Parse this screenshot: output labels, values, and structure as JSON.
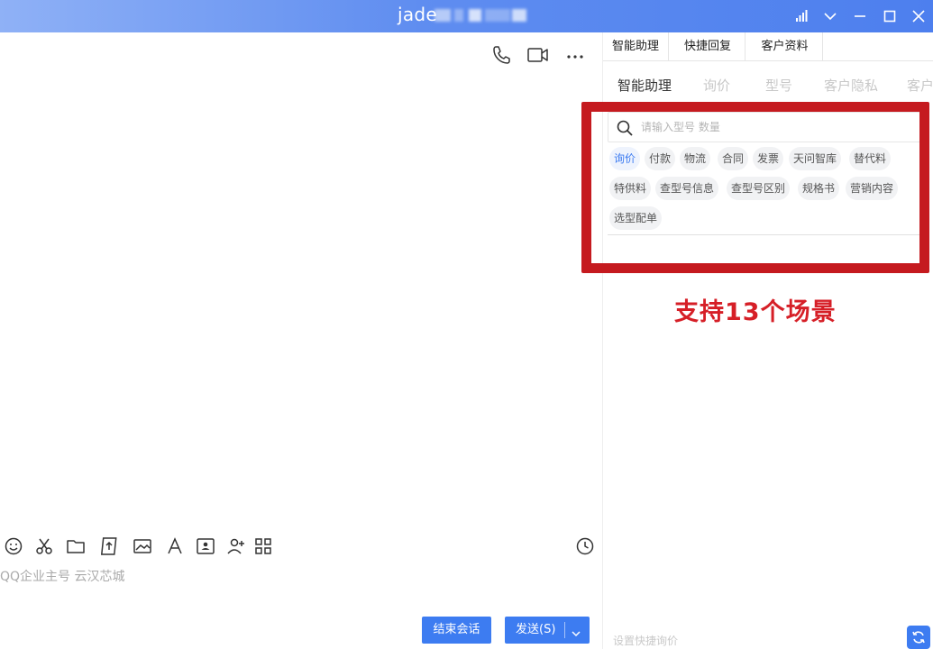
{
  "window": {
    "title": "jade"
  },
  "chat": {
    "input_placeholder": "QQ企业主号 云汉芯城",
    "end_button": "结束会话",
    "send_button": "发送(S)"
  },
  "panel": {
    "tabs": [
      "智能助理",
      "快捷回复",
      "客户资料"
    ],
    "subtabs": [
      "智能助理",
      "询价",
      "型号",
      "客户隐私",
      "客户"
    ],
    "search_placeholder": "请输入型号 数量",
    "chips": [
      "询价",
      "付款",
      "物流",
      "合同",
      "发票",
      "天问智库",
      "替代料",
      "特供料",
      "查型号信息",
      "查型号区别",
      "规格书",
      "营销内容",
      "选型配单"
    ],
    "quick_reply_hint": "设置快捷询价"
  },
  "annotation": {
    "text": "支持13个场景",
    "color": "#d61f27"
  },
  "colors": {
    "accent": "#3d7cf1",
    "highlight_frame": "#c51a1f"
  },
  "icons": {
    "titlebar": [
      "signal-icon",
      "chevron-down-icon",
      "minimize-icon",
      "maximize-icon",
      "close-icon"
    ],
    "chat_header": [
      "phone-icon",
      "video-call-icon",
      "more-icon"
    ],
    "input_toolbar": [
      "emoji-icon",
      "scissors-icon",
      "folder-icon",
      "upload-file-icon",
      "image-icon",
      "font-icon",
      "contact-card-icon",
      "add-person-icon",
      "apps-icon",
      "history-icon"
    ]
  }
}
